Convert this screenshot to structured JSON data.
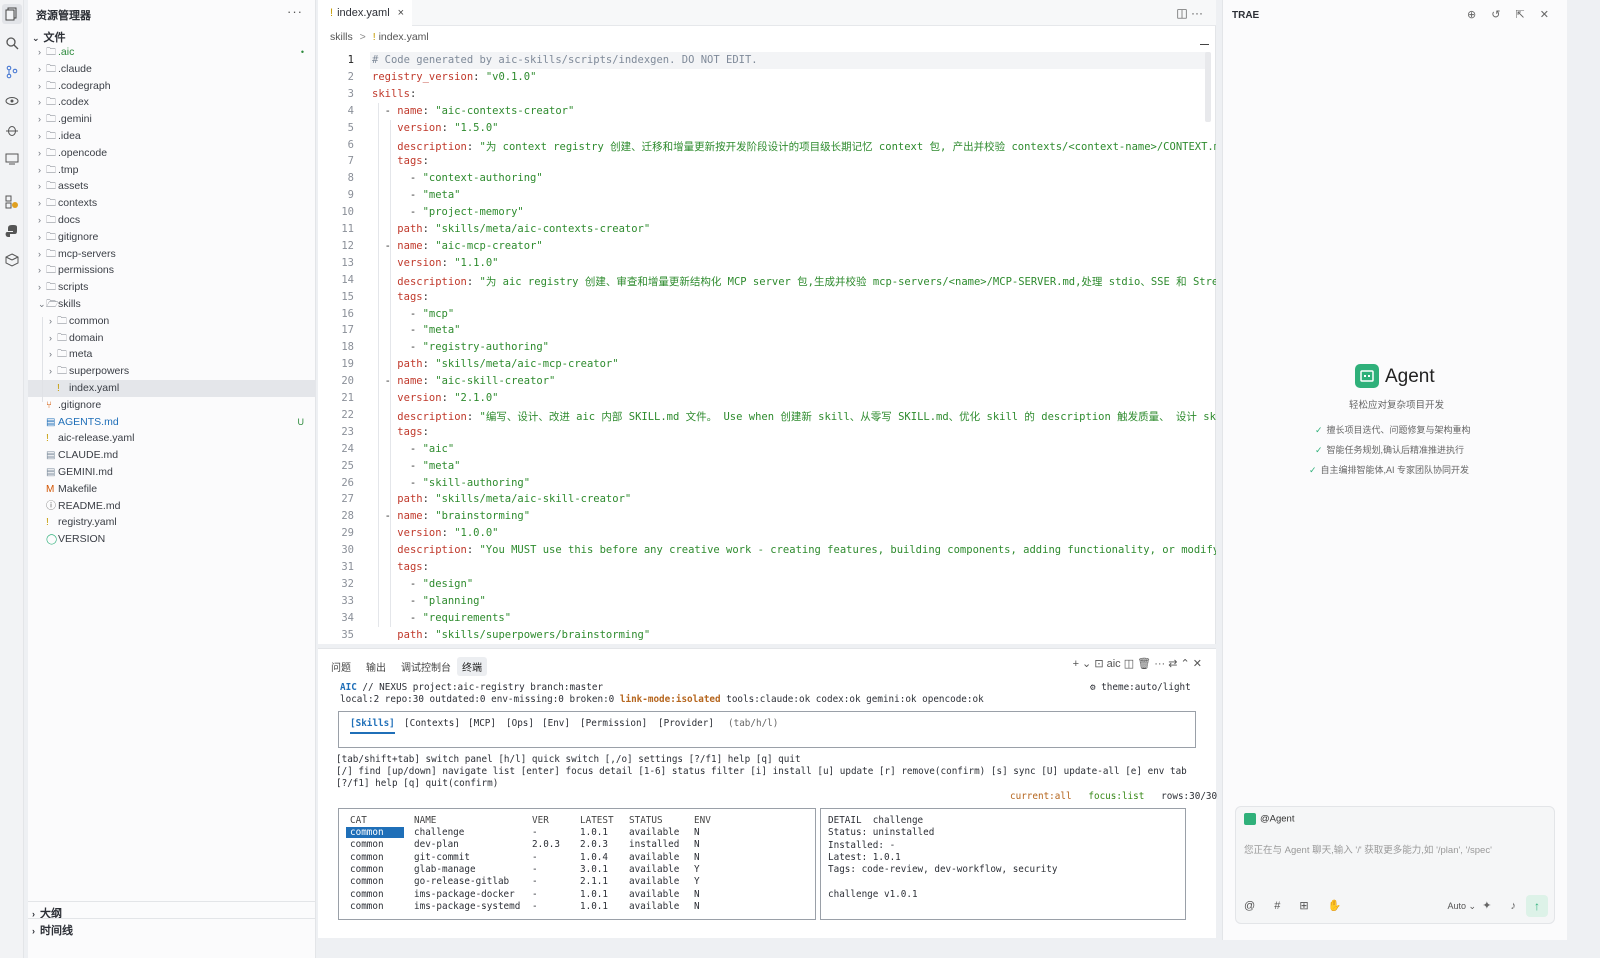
{
  "explorer": {
    "title": "资源管理器",
    "more": "···",
    "section_files": "文件",
    "items": [
      {
        "name": ".aic",
        "indent": 0,
        "type": "folder",
        "color": "#2d8a3c",
        "badge": "•"
      },
      {
        "name": ".claude",
        "indent": 0,
        "type": "folder"
      },
      {
        "name": ".codegraph",
        "indent": 0,
        "type": "folder"
      },
      {
        "name": ".codex",
        "indent": 0,
        "type": "folder"
      },
      {
        "name": ".gemini",
        "indent": 0,
        "type": "folder"
      },
      {
        "name": ".idea",
        "indent": 0,
        "type": "folder"
      },
      {
        "name": ".opencode",
        "indent": 0,
        "type": "folder"
      },
      {
        "name": ".tmp",
        "indent": 0,
        "type": "folder"
      },
      {
        "name": "assets",
        "indent": 0,
        "type": "folder"
      },
      {
        "name": "contexts",
        "indent": 0,
        "type": "folder"
      },
      {
        "name": "docs",
        "indent": 0,
        "type": "folder"
      },
      {
        "name": "gitignore",
        "indent": 0,
        "type": "folder"
      },
      {
        "name": "mcp-servers",
        "indent": 0,
        "type": "folder"
      },
      {
        "name": "permissions",
        "indent": 0,
        "type": "folder"
      },
      {
        "name": "scripts",
        "indent": 0,
        "type": "folder"
      },
      {
        "name": "skills",
        "indent": 0,
        "type": "folder-open"
      },
      {
        "name": "common",
        "indent": 1,
        "type": "folder"
      },
      {
        "name": "domain",
        "indent": 1,
        "type": "folder"
      },
      {
        "name": "meta",
        "indent": 1,
        "type": "folder"
      },
      {
        "name": "superpowers",
        "indent": 1,
        "type": "folder"
      },
      {
        "name": "index.yaml",
        "indent": 1,
        "type": "yaml",
        "selected": true
      },
      {
        "name": ".gitignore",
        "indent": 0,
        "type": "git"
      },
      {
        "name": "AGENTS.md",
        "indent": 0,
        "type": "md",
        "color": "#1f6fb8",
        "badge": "U"
      },
      {
        "name": "aic-release.yaml",
        "indent": 0,
        "type": "yaml"
      },
      {
        "name": "CLAUDE.md",
        "indent": 0,
        "type": "md-gray"
      },
      {
        "name": "GEMINI.md",
        "indent": 0,
        "type": "md-gray"
      },
      {
        "name": "Makefile",
        "indent": 0,
        "type": "make"
      },
      {
        "name": "README.md",
        "indent": 0,
        "type": "info"
      },
      {
        "name": "registry.yaml",
        "indent": 0,
        "type": "yaml"
      },
      {
        "name": "VERSION",
        "indent": 0,
        "type": "version"
      }
    ],
    "section_outline": "大纲",
    "section_timeline": "时间线"
  },
  "editor": {
    "tab_label": "index.yaml",
    "tab_mark": "!",
    "tab_close": "×",
    "tools": "◫  ···",
    "breadcrumb": {
      "root": "skills",
      "sep": ">",
      "mark": "!",
      "file": "index.yaml"
    },
    "lines": [
      [
        [
          "c",
          "# Code generated by aic-skills/scripts/indexgen. DO NOT EDIT."
        ]
      ],
      [
        [
          "k",
          "registry_version"
        ],
        [
          "p",
          ": "
        ],
        [
          "s",
          "\"v0.1.0\""
        ]
      ],
      [
        [
          "k",
          "skills"
        ],
        [
          "p",
          ":"
        ]
      ],
      [
        [
          "p",
          "  - "
        ],
        [
          "k",
          "name"
        ],
        [
          "p",
          ": "
        ],
        [
          "s",
          "\"aic-contexts-creator\""
        ]
      ],
      [
        [
          "p",
          "    "
        ],
        [
          "k",
          "version"
        ],
        [
          "p",
          ": "
        ],
        [
          "s",
          "\"1.5.0\""
        ]
      ],
      [
        [
          "p",
          "    "
        ],
        [
          "k",
          "description"
        ],
        [
          "p",
          ": "
        ],
        [
          "s",
          "\"为 context registry 创建、迁移和增量更新按开发阶段设计的项目级长期记忆 context 包, 产出并校验 contexts/<context-name>/CONTEXT.md 与"
        ]
      ],
      [
        [
          "p",
          "    "
        ],
        [
          "k",
          "tags"
        ],
        [
          "p",
          ":"
        ]
      ],
      [
        [
          "p",
          "      - "
        ],
        [
          "s",
          "\"context-authoring\""
        ]
      ],
      [
        [
          "p",
          "      - "
        ],
        [
          "s",
          "\"meta\""
        ]
      ],
      [
        [
          "p",
          "      - "
        ],
        [
          "s",
          "\"project-memory\""
        ]
      ],
      [
        [
          "p",
          "    "
        ],
        [
          "k",
          "path"
        ],
        [
          "p",
          ": "
        ],
        [
          "s",
          "\"skills/meta/aic-contexts-creator\""
        ]
      ],
      [
        [
          "p",
          "  - "
        ],
        [
          "k",
          "name"
        ],
        [
          "p",
          ": "
        ],
        [
          "s",
          "\"aic-mcp-creator\""
        ]
      ],
      [
        [
          "p",
          "    "
        ],
        [
          "k",
          "version"
        ],
        [
          "p",
          ": "
        ],
        [
          "s",
          "\"1.1.0\""
        ]
      ],
      [
        [
          "p",
          "    "
        ],
        [
          "k",
          "description"
        ],
        [
          "p",
          ": "
        ],
        [
          "s",
          "\"为 aic registry 创建、审查和增量更新结构化 MCP server 包,生成并校验 mcp-servers/<name>/MCP-SERVER.md,处理 stdio、SSE 和 Streamab"
        ]
      ],
      [
        [
          "p",
          "    "
        ],
        [
          "k",
          "tags"
        ],
        [
          "p",
          ":"
        ]
      ],
      [
        [
          "p",
          "      - "
        ],
        [
          "s",
          "\"mcp\""
        ]
      ],
      [
        [
          "p",
          "      - "
        ],
        [
          "s",
          "\"meta\""
        ]
      ],
      [
        [
          "p",
          "      - "
        ],
        [
          "s",
          "\"registry-authoring\""
        ]
      ],
      [
        [
          "p",
          "    "
        ],
        [
          "k",
          "path"
        ],
        [
          "p",
          ": "
        ],
        [
          "s",
          "\"skills/meta/aic-mcp-creator\""
        ]
      ],
      [
        [
          "p",
          "  - "
        ],
        [
          "k",
          "name"
        ],
        [
          "p",
          ": "
        ],
        [
          "s",
          "\"aic-skill-creator\""
        ]
      ],
      [
        [
          "p",
          "    "
        ],
        [
          "k",
          "version"
        ],
        [
          "p",
          ": "
        ],
        [
          "s",
          "\"2.1.0\""
        ]
      ],
      [
        [
          "p",
          "    "
        ],
        [
          "k",
          "description"
        ],
        [
          "p",
          ": "
        ],
        [
          "s",
          "\"编写、设计、改进 aic 内部 SKILL.md 文件。 Use when 创建新 skill、从零写 SKILL.md、优化 skill 的 description 触发质量、 设计 skill 目"
        ]
      ],
      [
        [
          "p",
          "    "
        ],
        [
          "k",
          "tags"
        ],
        [
          "p",
          ":"
        ]
      ],
      [
        [
          "p",
          "      - "
        ],
        [
          "s",
          "\"aic\""
        ]
      ],
      [
        [
          "p",
          "      - "
        ],
        [
          "s",
          "\"meta\""
        ]
      ],
      [
        [
          "p",
          "      - "
        ],
        [
          "s",
          "\"skill-authoring\""
        ]
      ],
      [
        [
          "p",
          "    "
        ],
        [
          "k",
          "path"
        ],
        [
          "p",
          ": "
        ],
        [
          "s",
          "\"skills/meta/aic-skill-creator\""
        ]
      ],
      [
        [
          "p",
          "  - "
        ],
        [
          "k",
          "name"
        ],
        [
          "p",
          ": "
        ],
        [
          "s",
          "\"brainstorming\""
        ]
      ],
      [
        [
          "p",
          "    "
        ],
        [
          "k",
          "version"
        ],
        [
          "p",
          ": "
        ],
        [
          "s",
          "\"1.0.0\""
        ]
      ],
      [
        [
          "p",
          "    "
        ],
        [
          "k",
          "description"
        ],
        [
          "p",
          ": "
        ],
        [
          "s",
          "\"You MUST use this before any creative work - creating features, building components, adding functionality, or modifying b"
        ]
      ],
      [
        [
          "p",
          "    "
        ],
        [
          "k",
          "tags"
        ],
        [
          "p",
          ":"
        ]
      ],
      [
        [
          "p",
          "      - "
        ],
        [
          "s",
          "\"design\""
        ]
      ],
      [
        [
          "p",
          "      - "
        ],
        [
          "s",
          "\"planning\""
        ]
      ],
      [
        [
          "p",
          "      - "
        ],
        [
          "s",
          "\"requirements\""
        ]
      ],
      [
        [
          "p",
          "    "
        ],
        [
          "k",
          "path"
        ],
        [
          "p",
          ": "
        ],
        [
          "s",
          "\"skills/superpowers/brainstorming\""
        ]
      ]
    ]
  },
  "panel": {
    "tabs": [
      "问题",
      "输出",
      "调试控制台",
      "终端"
    ],
    "active_tab": "终端",
    "tools": "+ ⌄  ⊡ aic  ◫  🗑  ···   ⇄  ⌃  ✕",
    "header_line1": {
      "brand": "AIC",
      "rest": " // NEXUS project:aic-registry branch:master",
      "theme": "⚙ theme:auto/light"
    },
    "header_line2": {
      "a": "local:2 repo:30 outdated:0 env-missing:0 broken:0 ",
      "b": "link-mode:isolated",
      "c": " tools:claude:ok codex:ok gemini:ok opencode:ok"
    },
    "nav_tabs": [
      "[Skills]",
      "[Contexts]",
      "[MCP]",
      "[Ops]",
      "[Env]",
      "[Permission]",
      "[Provider]"
    ],
    "nav_hint": "(tab/h/l)",
    "help_lines": [
      "[tab/shift+tab] switch panel [h/l] quick switch [,/o] settings [?/f1] help [q] quit",
      "[/] find [up/down] navigate list [enter] focus detail [1-6] status filter [i] install [u] update [r] remove(confirm) [s] sync [U] update-all [e] env tab",
      "[?/f1] help [q] quit(confirm)"
    ],
    "status": {
      "current": "current:all",
      "focus": "focus:list",
      "rows": "rows:30/30"
    },
    "table_headers": [
      "CAT",
      "NAME",
      "VER",
      "LATEST",
      "STATUS",
      "ENV"
    ],
    "table_rows": [
      [
        "common",
        "challenge",
        "-",
        "1.0.1",
        "available",
        "N"
      ],
      [
        "common",
        "dev-plan",
        "2.0.3",
        "2.0.3",
        "installed",
        "N"
      ],
      [
        "common",
        "git-commit",
        "-",
        "1.0.4",
        "available",
        "N"
      ],
      [
        "common",
        "glab-manage",
        "-",
        "3.0.1",
        "available",
        "Y"
      ],
      [
        "common",
        "go-release-gitlab",
        "-",
        "2.1.1",
        "available",
        "Y"
      ],
      [
        "common",
        "ims-package-docker",
        "-",
        "1.0.1",
        "available",
        "N"
      ],
      [
        "common",
        "ims-package-systemd",
        "-",
        "1.0.1",
        "available",
        "N"
      ]
    ],
    "detail_lines": [
      "DETAIL  challenge",
      "Status: uninstalled",
      "Installed: -",
      "Latest: 1.0.1",
      "Tags: code-review, dev-workflow, security",
      "",
      "challenge v1.0.1"
    ]
  },
  "right": {
    "title": "TRAE",
    "tools": "⊕ ↺ ⇱  ✕",
    "agent_title": "Agent",
    "agent_sub": "轻松应对复杂项目开发",
    "features": [
      "擅长项目迭代、问题修复与架构重构",
      "智能任务规划,确认后精准推进执行",
      "自主编排智能体,AI 专家团队协同开发"
    ],
    "chat_chip": "@Agent",
    "chat_placeholder": "您正在与 Agent 聊天,输入 '/' 获取更多能力,如 '/plan', '/spec'",
    "chat_tools": "@ # ⊞ ✋",
    "auto_label": "Auto ⌄",
    "chat_right_tools": "✦ ♪",
    "send": "↑"
  }
}
